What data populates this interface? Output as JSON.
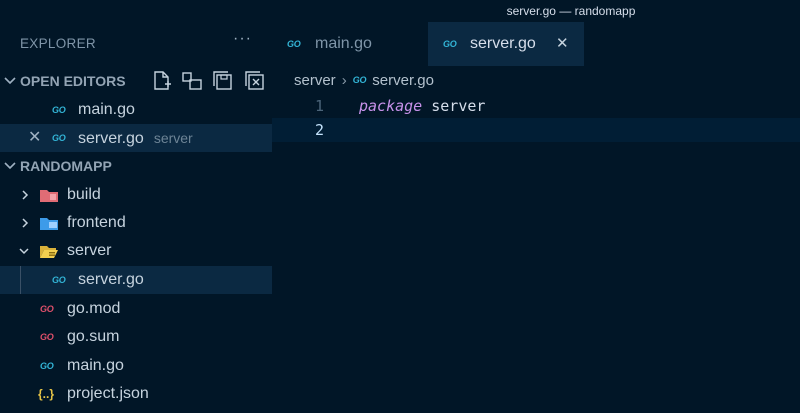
{
  "window": {
    "title": "server.go — randomapp"
  },
  "sidebar": {
    "header": "EXPLORER",
    "more_label": "···",
    "open_editors": {
      "label": "OPEN EDITORS",
      "items": [
        {
          "name": "main.go",
          "icon": "GO",
          "detail": ""
        },
        {
          "name": "server.go",
          "icon": "GO",
          "detail": "server"
        }
      ]
    },
    "workspace": {
      "label": "RANDOMAPP",
      "items": [
        {
          "name": "build",
          "type": "folder"
        },
        {
          "name": "frontend",
          "type": "folder"
        },
        {
          "name": "server",
          "type": "folder",
          "expanded": true
        },
        {
          "name": "server.go",
          "type": "file",
          "icon": "GO"
        },
        {
          "name": "go.mod",
          "type": "file",
          "icon": "GO"
        },
        {
          "name": "go.sum",
          "type": "file",
          "icon": "GO"
        },
        {
          "name": "main.go",
          "type": "file",
          "icon": "GO"
        },
        {
          "name": "project.json",
          "type": "file",
          "icon": "{..}"
        }
      ]
    }
  },
  "tabs": [
    {
      "label": "main.go",
      "icon": "GO",
      "active": false
    },
    {
      "label": "server.go",
      "icon": "GO",
      "active": true,
      "close": "✕"
    }
  ],
  "breadcrumb": {
    "folder": "server",
    "file": "server.go",
    "icon": "GO"
  },
  "editor": {
    "lines": [
      {
        "number": "1",
        "keyword": "package",
        "text": "server"
      },
      {
        "number": "2",
        "keyword": "",
        "text": ""
      }
    ]
  },
  "colors": {
    "background": "#011627",
    "active": "#0b2942",
    "go_blue": "#33b5d7",
    "go_red": "#e0506b",
    "keyword": "#c792ea"
  }
}
